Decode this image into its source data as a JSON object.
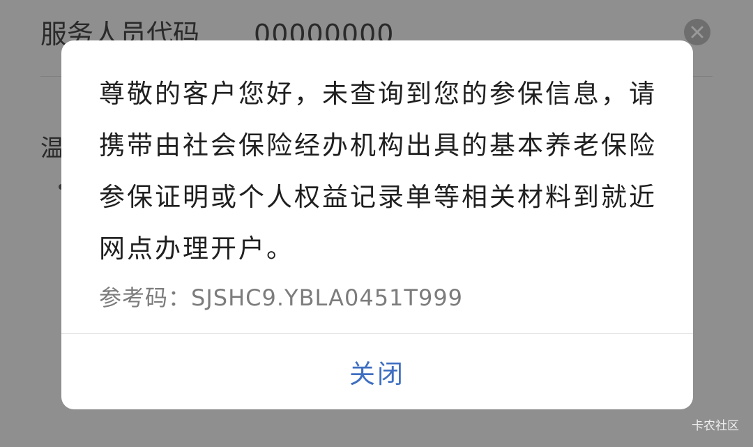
{
  "background": {
    "field_label": "服务人员代码",
    "field_value": "00000000",
    "partial_text": "温",
    "close_icon": "close-icon"
  },
  "dialog": {
    "message": "尊敬的客户您好，未查询到您的参保信息，请携带由社会保险经办机构出具的基本养老保险参保证明或个人权益记录单等相关材料到就近网点办理开户。",
    "reference_label": "参考码：",
    "reference_code": "SJSHC9.YBLA0451T999",
    "close_label": "关闭"
  },
  "watermark": "卡农社区"
}
